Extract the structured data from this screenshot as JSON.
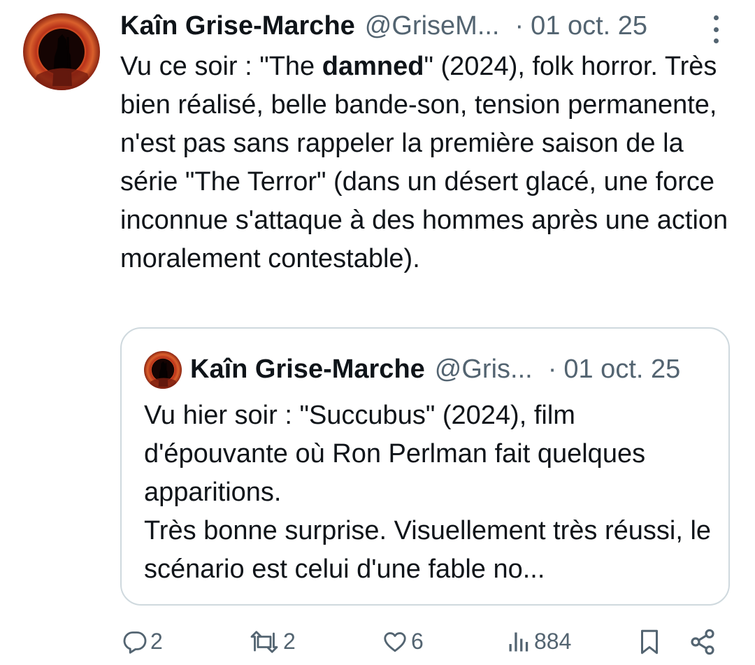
{
  "tweet": {
    "author_name": "Kaîn Grise-Marche",
    "handle": "@GriseM...",
    "separator": "·",
    "date": "01 oct. 25",
    "text_before": "Vu ce soir : \"The ",
    "text_bold": "damned",
    "text_after": "\" (2024), folk horror. Très bien réalisé, belle bande-son, tension permanente, n'est pas sans rappeler la première saison de la série \"The Terror\" (dans un désert glacé, une force inconnue s'attaque à des hommes après une action moralement contestable)."
  },
  "quote": {
    "author_name": "Kaîn Grise-Marche",
    "handle": "@Gris...",
    "separator": "·",
    "date": "01 oct. 25",
    "line1": "Vu hier soir : \"Succubus\" (2024), film d'épouvante où Ron Perlman fait quelques apparitions.",
    "line2": "Très bonne surprise. Visuellement très réussi, le scénario est celui d'une fable no..."
  },
  "actions": {
    "replies": "2",
    "reposts": "2",
    "likes": "6",
    "views": "884"
  },
  "icons": {
    "more": "more-vertical-icon",
    "reply": "reply-icon",
    "repost": "repost-icon",
    "like": "heart-icon",
    "views": "views-icon",
    "bookmark": "bookmark-icon",
    "share": "share-icon"
  },
  "colors": {
    "text": "#0f1419",
    "secondary": "#536471",
    "border": "#cfd9de"
  }
}
